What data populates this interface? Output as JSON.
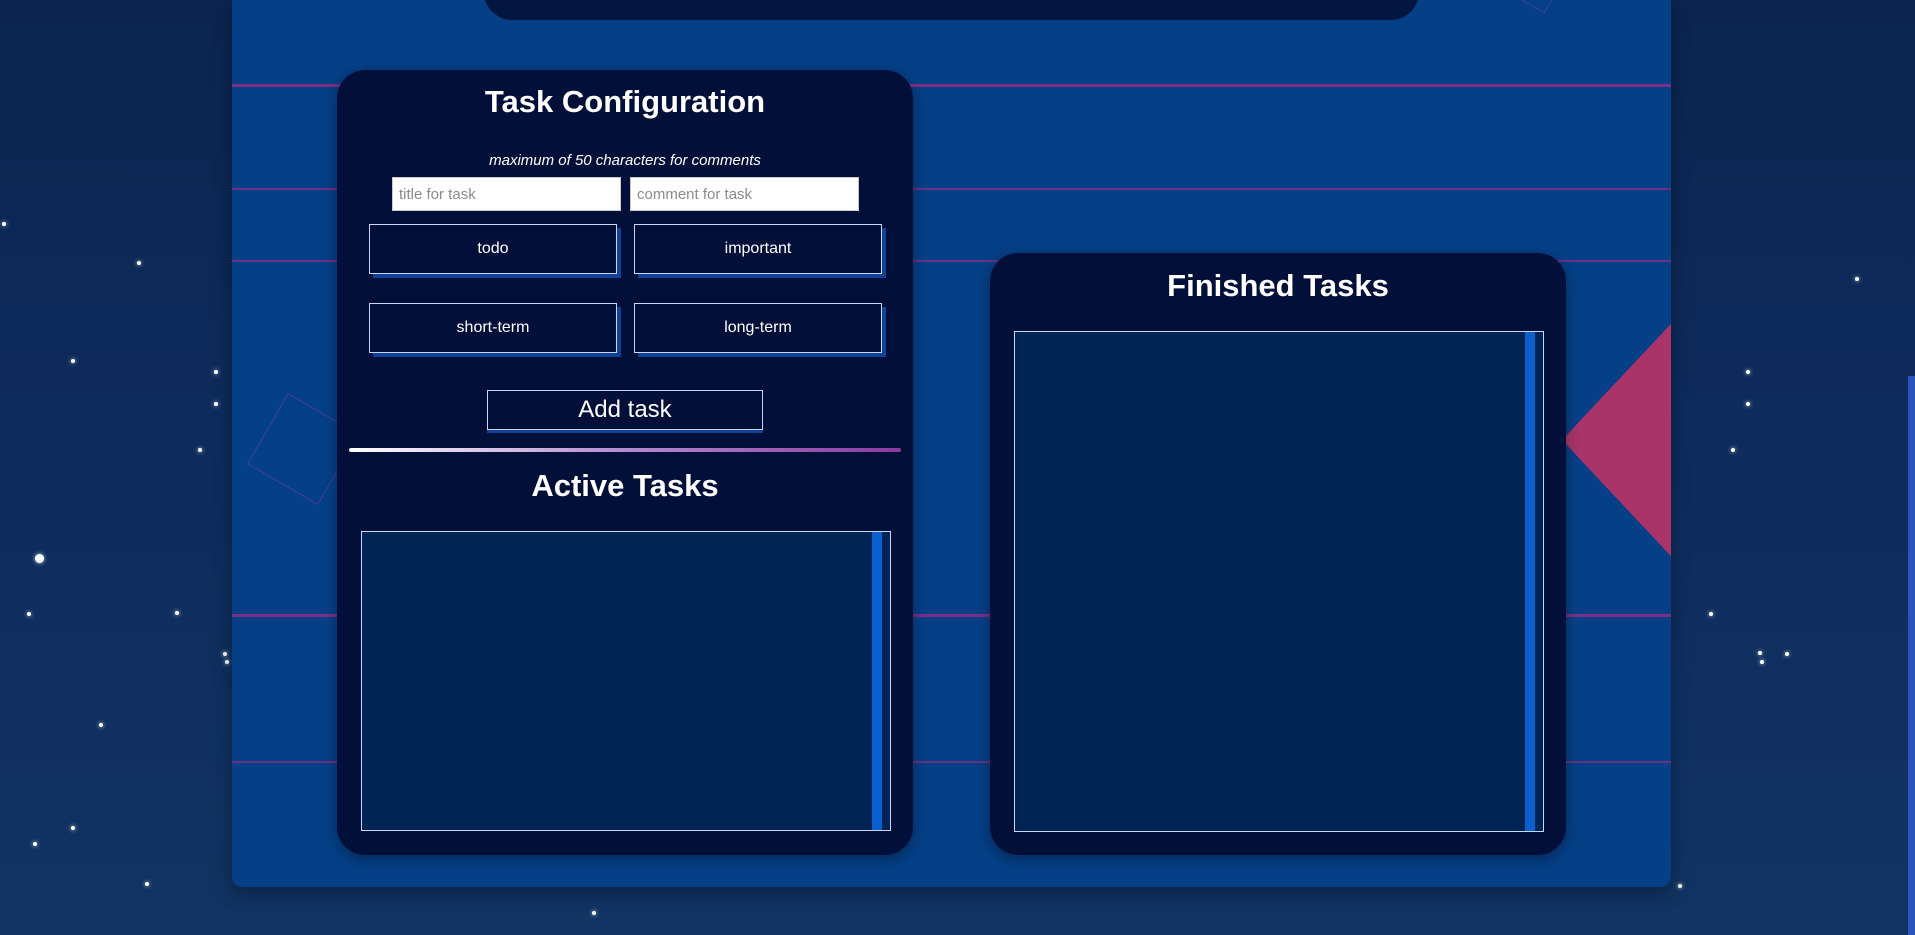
{
  "config_card": {
    "title": "Task Configuration",
    "hint": "maximum of 50 characters for comments",
    "title_input": {
      "placeholder": "title for task",
      "value": ""
    },
    "comment_input": {
      "placeholder": "comment for task",
      "value": ""
    },
    "categories": [
      {
        "label": "todo"
      },
      {
        "label": "important"
      },
      {
        "label": "short-term"
      },
      {
        "label": "long-term"
      }
    ],
    "add_button": "Add task"
  },
  "active_tasks": {
    "title": "Active Tasks",
    "items": []
  },
  "finished_tasks": {
    "title": "Finished Tasks",
    "items": []
  },
  "colors": {
    "page_background": "#0b2550",
    "panel_background": "#053f86",
    "card_background": "#021039",
    "list_background": "#002454",
    "stripe_color": "#8b2d86",
    "accent_blue": "#0b5fcf",
    "decoration_pink": "#b13468"
  }
}
